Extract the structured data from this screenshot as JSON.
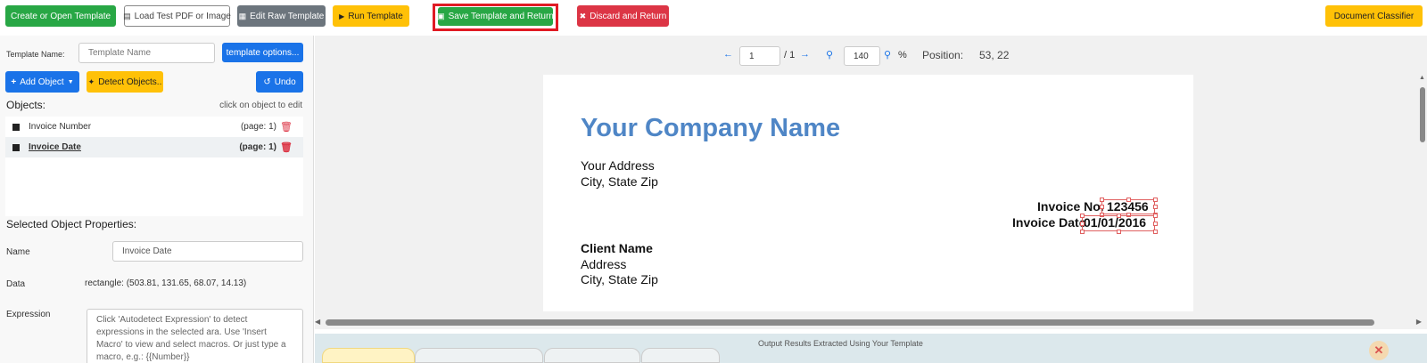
{
  "toolbar": {
    "create_open": "Create or Open Template",
    "load_test": "Load Test PDF or Image",
    "edit_raw": "Edit Raw Template",
    "run": "Run Template",
    "save_return": "Save Template and Return",
    "discard_return": "Discard and Return",
    "doc_classifier": "Document Classifier"
  },
  "left": {
    "template_name_label": "Template Name:",
    "template_name_placeholder": "Template Name",
    "template_options": "template options...",
    "add_object": "Add Object",
    "detect_objects": "Detect Objects..",
    "undo": "Undo",
    "objects_label": "Objects:",
    "objects_hint": "click on object to edit",
    "objects": [
      {
        "name": "Invoice Number",
        "page": "(page: 1)"
      },
      {
        "name": "Invoice Date",
        "page": "(page: 1)"
      }
    ],
    "selected_props_label": "Selected Object Properties:",
    "name_label": "Name",
    "name_value": "Invoice Date",
    "data_label": "Data",
    "data_value": "rectangle: (503.81, 131.65, 68.07, 14.13)",
    "expression_label": "Expression",
    "expression_placeholder": "Click 'Autodetect Expression' to detect expressions in the selected ara. Use 'Insert Macro' to view and select macros. Or just type a macro, e.g.: {{Number}}"
  },
  "viewer": {
    "page_value": "1",
    "page_total": "/ 1",
    "zoom_value": "140",
    "zoom_unit": "%",
    "position_label": "Position:",
    "position_value": "53, 22"
  },
  "document": {
    "company": "Your Company Name",
    "address_line1": "Your Address",
    "address_line2": "City, State Zip",
    "invoice_no_label": "Invoice No.",
    "invoice_no_value": "123456",
    "invoice_date_label": "Invoice Date",
    "invoice_date_value": "01/01/2016",
    "client_name": "Client Name",
    "client_address": "Address",
    "client_city": "City, State Zip"
  },
  "bottom": {
    "title": "Output Results Extracted Using Your Template"
  },
  "colors": {
    "accent_blue": "#1a73e8",
    "green": "#28a745",
    "yellow": "#ffc107",
    "red": "#dc3545",
    "company_blue": "#4f86c6",
    "highlight_red": "#e01b24"
  },
  "icons": [
    "save-icon",
    "pdf-file-icon",
    "edit-icon",
    "play-icon",
    "close-icon",
    "plus-icon",
    "caret-down-icon",
    "magic-wand-icon",
    "undo-icon",
    "trash-icon",
    "arrow-left-icon",
    "arrow-right-icon",
    "zoom-in-icon",
    "zoom-out-icon",
    "close-circle-icon"
  ]
}
